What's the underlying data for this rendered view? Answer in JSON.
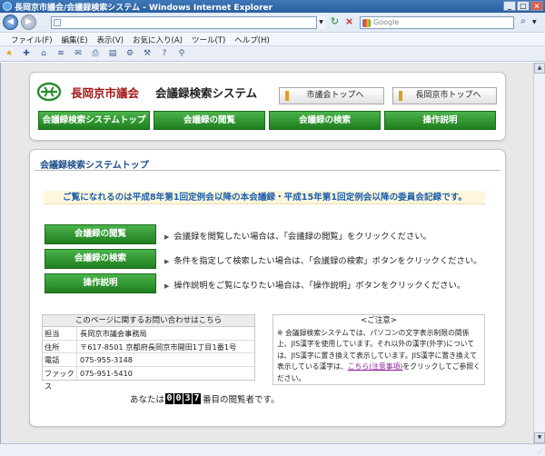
{
  "window": {
    "title": "長岡京市議会/会議録検索システム - Windows Internet Explorer"
  },
  "addressbar": {
    "url": "",
    "search_placeholder": "Google"
  },
  "menu": [
    "ファイル(F)",
    "編集(E)",
    "表示(V)",
    "お気に入り(A)",
    "ツール(T)",
    "ヘルプ(H)"
  ],
  "header": {
    "site_name": "長岡京市議会",
    "system_name": "会議録検索システム",
    "links": {
      "gikai_top": "市議会トップへ",
      "city_top": "長岡京市トップへ"
    },
    "nav": {
      "top": "会議録検索システムトップ",
      "browse": "会議録の閲覧",
      "search": "会議録の検索",
      "help": "操作説明"
    }
  },
  "main": {
    "title": "会議録検索システムトップ",
    "notice": "ご覧になれるのは平成8年第1回定例会以降の本会議録・平成15年第1回定例会以降の委員会記録です。",
    "actions": {
      "browse_label": "会議録の閲覧",
      "browse_desc": "会議録を閲覧したい場合は、「会議録の閲覧」をクリックください。",
      "search_label": "会議録の検索",
      "search_desc": "条件を指定して検索したい場合は、「会議録の検索」ボタンをクリックください。",
      "help_label": "操作説明",
      "help_desc": "操作説明をご覧になりたい場合は、「操作説明」ボタンをクリックください。"
    }
  },
  "contact": {
    "heading": "このページに関するお問い合わせはこちら",
    "rows": [
      {
        "key": "担当",
        "value": "長岡京市議会事務局"
      },
      {
        "key": "住所",
        "value": "〒617-8501 京都府長岡京市開田1丁目1番1号"
      },
      {
        "key": "電話",
        "value": "075-955-3148"
      },
      {
        "key": "ファックス",
        "value": "075-951-5410"
      }
    ]
  },
  "caution": {
    "heading": "<ご注意>",
    "body": "※ 会議録検索システムでは、パソコンの文字表示制限の関係上、JIS漢字を使用しています。それ以外の漢字(外字)については、JIS漢字に置き換えて表示しています。JIS漢字に置き換えて表示している漢字は、",
    "link": "こちら(注意事項)",
    "body_after": "をクリックしてご参照ください。"
  },
  "counter": {
    "prefix": "あなたは",
    "digits": [
      "0",
      "0",
      "3",
      "7"
    ],
    "suffix": "番目の閲覧者です。"
  },
  "colors": {
    "nav_green": "#2a8f2a",
    "site_name_red": "#a01818",
    "title_blue": "#1e4d8a",
    "notice_blue": "#1c5fb0",
    "link_accent": "#e89b1b"
  }
}
